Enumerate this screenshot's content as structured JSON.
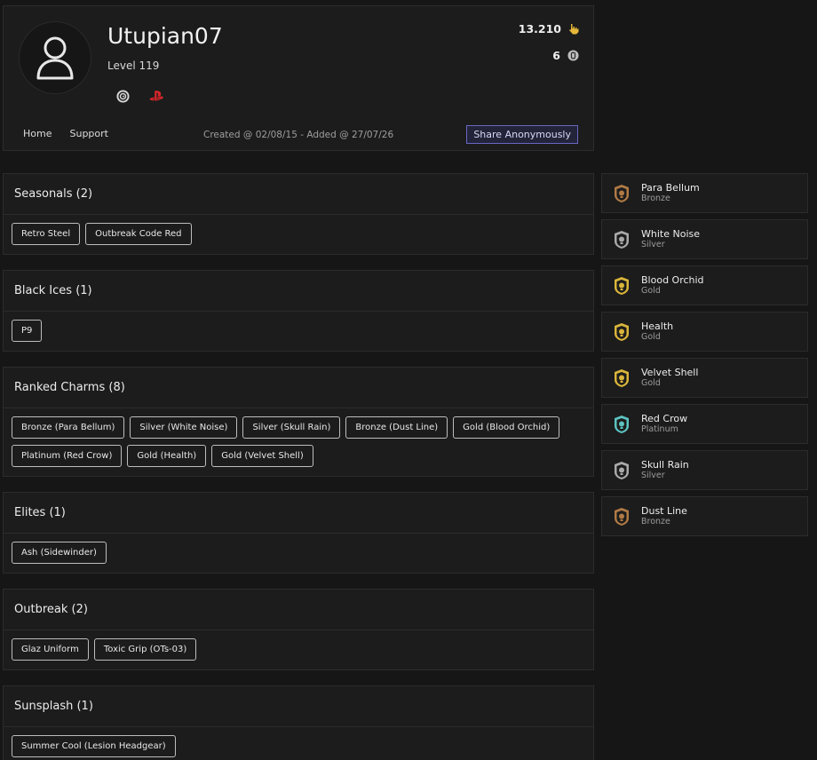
{
  "profile": {
    "username": "Utupian07",
    "level": "Level 119",
    "stats": [
      {
        "value": "13.210",
        "icon": "renown-hand-icon"
      },
      {
        "value": "6",
        "icon": "r6-credits-coin-icon"
      }
    ],
    "platforms": [
      "ubisoft-icon",
      "playstation-icon"
    ],
    "nav": [
      "Home",
      "Support"
    ],
    "created": "Created @ 02/08/15 - Added @ 27/07/26",
    "share_label": "Share Anonymously"
  },
  "sections": [
    {
      "title": "Seasonals (2)",
      "items": [
        "Retro Steel",
        "Outbreak Code Red"
      ]
    },
    {
      "title": "Black Ices (1)",
      "items": [
        "P9"
      ]
    },
    {
      "title": "Ranked Charms (8)",
      "items": [
        "Bronze (Para Bellum)",
        "Silver (White Noise)",
        "Silver (Skull Rain)",
        "Bronze (Dust Line)",
        "Gold (Blood Orchid)",
        "Platinum (Red Crow)",
        "Gold (Health)",
        "Gold (Velvet Shell)"
      ]
    },
    {
      "title": "Elites (1)",
      "items": [
        "Ash (Sidewinder)"
      ]
    },
    {
      "title": "Outbreak (2)",
      "items": [
        "Glaz Uniform",
        "Toxic Grip (OTs-03)"
      ]
    },
    {
      "title": "Sunsplash (1)",
      "items": [
        "Summer Cool (Lesion Headgear)"
      ]
    }
  ],
  "charms": [
    {
      "name": "Para Bellum",
      "tier": "Bronze",
      "color": "#b07a45"
    },
    {
      "name": "White Noise",
      "tier": "Silver",
      "color": "#a9a9a9"
    },
    {
      "name": "Blood Orchid",
      "tier": "Gold",
      "color": "#d9b53a"
    },
    {
      "name": "Health",
      "tier": "Gold",
      "color": "#d9b53a"
    },
    {
      "name": "Velvet Shell",
      "tier": "Gold",
      "color": "#d9b53a"
    },
    {
      "name": "Red Crow",
      "tier": "Platinum",
      "color": "#5cc2c0"
    },
    {
      "name": "Skull Rain",
      "tier": "Silver",
      "color": "#a9a9a9"
    },
    {
      "name": "Dust Line",
      "tier": "Bronze",
      "color": "#b07a45"
    }
  ],
  "colors": {
    "accent": "#6a68c4",
    "playstation": "#d8262b",
    "renown": "#e5b83a"
  }
}
